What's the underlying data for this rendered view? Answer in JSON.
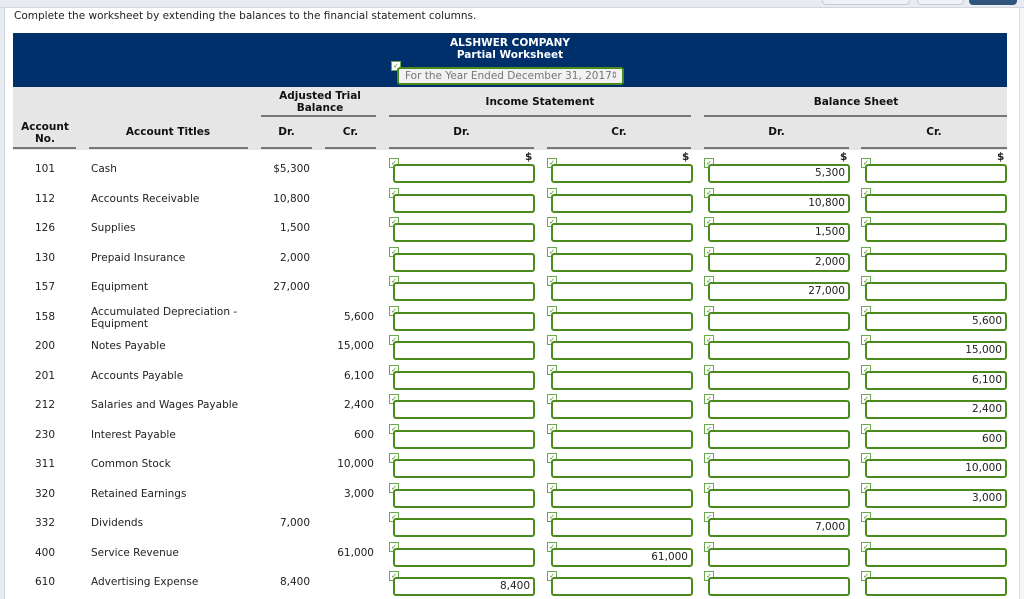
{
  "instruction": "Complete the worksheet by extending the balances to the financial statement columns.",
  "header": {
    "company": "ALSHWER COMPANY",
    "subtitle": "Partial Worksheet",
    "period_selected": "For the Year Ended December 31, 2017",
    "period_arrow": "⇕"
  },
  "columns": {
    "account_no": "Account No.",
    "account_titles": "Account Titles",
    "adjusted_trial_balance": "Adjusted Trial Balance",
    "income_statement": "Income Statement",
    "balance_sheet": "Balance Sheet",
    "dr": "Dr.",
    "cr": "Cr.",
    "dollar": "$"
  },
  "check_icon": "✓",
  "rows": [
    {
      "no": "101",
      "title": "Cash",
      "atb_dr": "$5,300",
      "atb_cr": "",
      "is_dr": "",
      "is_cr": "",
      "bs_dr": "5,300",
      "bs_cr": ""
    },
    {
      "no": "112",
      "title": "Accounts Receivable",
      "atb_dr": "10,800",
      "atb_cr": "",
      "is_dr": "",
      "is_cr": "",
      "bs_dr": "10,800",
      "bs_cr": ""
    },
    {
      "no": "126",
      "title": "Supplies",
      "atb_dr": "1,500",
      "atb_cr": "",
      "is_dr": "",
      "is_cr": "",
      "bs_dr": "1,500",
      "bs_cr": ""
    },
    {
      "no": "130",
      "title": "Prepaid Insurance",
      "atb_dr": "2,000",
      "atb_cr": "",
      "is_dr": "",
      "is_cr": "",
      "bs_dr": "2,000",
      "bs_cr": ""
    },
    {
      "no": "157",
      "title": "Equipment",
      "atb_dr": "27,000",
      "atb_cr": "",
      "is_dr": "",
      "is_cr": "",
      "bs_dr": "27,000",
      "bs_cr": ""
    },
    {
      "no": "158",
      "title": "Accumulated Depreciation - Equipment",
      "atb_dr": "",
      "atb_cr": "5,600",
      "is_dr": "",
      "is_cr": "",
      "bs_dr": "",
      "bs_cr": "5,600"
    },
    {
      "no": "200",
      "title": "Notes Payable",
      "atb_dr": "",
      "atb_cr": "15,000",
      "is_dr": "",
      "is_cr": "",
      "bs_dr": "",
      "bs_cr": "15,000"
    },
    {
      "no": "201",
      "title": "Accounts Payable",
      "atb_dr": "",
      "atb_cr": "6,100",
      "is_dr": "",
      "is_cr": "",
      "bs_dr": "",
      "bs_cr": "6,100"
    },
    {
      "no": "212",
      "title": "Salaries and Wages Payable",
      "atb_dr": "",
      "atb_cr": "2,400",
      "is_dr": "",
      "is_cr": "",
      "bs_dr": "",
      "bs_cr": "2,400"
    },
    {
      "no": "230",
      "title": "Interest Payable",
      "atb_dr": "",
      "atb_cr": "600",
      "is_dr": "",
      "is_cr": "",
      "bs_dr": "",
      "bs_cr": "600"
    },
    {
      "no": "311",
      "title": "Common Stock",
      "atb_dr": "",
      "atb_cr": "10,000",
      "is_dr": "",
      "is_cr": "",
      "bs_dr": "",
      "bs_cr": "10,000"
    },
    {
      "no": "320",
      "title": "Retained Earnings",
      "atb_dr": "",
      "atb_cr": "3,000",
      "is_dr": "",
      "is_cr": "",
      "bs_dr": "",
      "bs_cr": "3,000"
    },
    {
      "no": "332",
      "title": "Dividends",
      "atb_dr": "7,000",
      "atb_cr": "",
      "is_dr": "",
      "is_cr": "",
      "bs_dr": "7,000",
      "bs_cr": ""
    },
    {
      "no": "400",
      "title": "Service Revenue",
      "atb_dr": "",
      "atb_cr": "61,000",
      "is_dr": "",
      "is_cr": "61,000",
      "bs_dr": "",
      "bs_cr": ""
    },
    {
      "no": "610",
      "title": "Advertising Expense",
      "atb_dr": "8,400",
      "atb_cr": "",
      "is_dr": "8,400",
      "is_cr": "",
      "bs_dr": "",
      "bs_cr": ""
    }
  ]
}
